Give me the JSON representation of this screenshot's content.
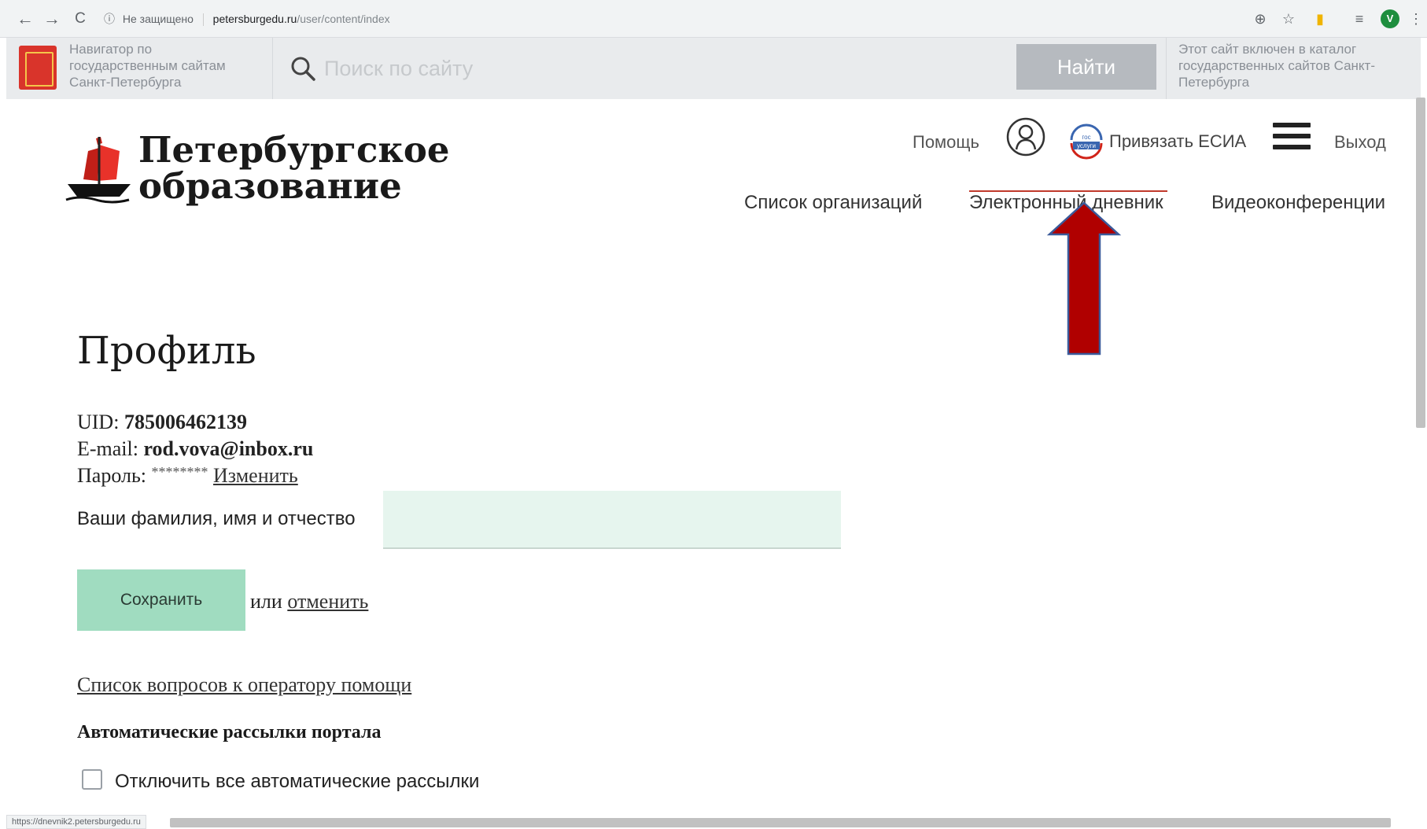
{
  "browser": {
    "back": "←",
    "forward": "→",
    "reload": "C",
    "security_icon": "ⓘ",
    "security_text": "Не защищено",
    "url_host": "petersburgedu.ru",
    "url_path": "/user/content/index",
    "zoom": "⊕",
    "star": "☆",
    "ext": "▮",
    "playlist": "≡",
    "avatar_letter": "V",
    "more": "⋮"
  },
  "gov_strip": {
    "navigator_text": "Навигатор по государственным сайтам Санкт-Петербурга",
    "search_placeholder": "Поиск по сайту",
    "find_label": "Найти",
    "catalog_text": "Этот сайт включен в каталог государственных сайтов Санкт-Петербурга"
  },
  "header": {
    "logo_line1": "Петербургское",
    "logo_line2": "образование",
    "help": "Помощь",
    "esia": "Привязать ЕСИА",
    "logout": "Выход",
    "gos_label_top": "гос",
    "gos_label_bottom": "услуги",
    "nav": [
      "Список организаций",
      "Электронный дневник",
      "Видеоконференции"
    ]
  },
  "profile": {
    "title": "Профиль",
    "uid_label": "UID: ",
    "uid_value": "785006462139",
    "email_label": "E-mail: ",
    "email_value": "rod.vova@inbox.ru",
    "password_label": "Пароль: ",
    "password_value": "********",
    "password_change": "Изменить",
    "fio_label": "Ваши фамилия, имя и отчество",
    "fio_value": "",
    "save_label": "Сохранить",
    "or_text": "или ",
    "cancel_label": "отменить",
    "questions_link": "Список вопросов к оператору помощи",
    "mailing_heading": "Автоматические рассылки портала",
    "mailing_checkbox_label": "Отключить все автоматические рассылки",
    "mailing_checked": false
  },
  "status_bar": {
    "url": "https://dnevnik2.petersburgedu.ru"
  },
  "colors": {
    "accent_green": "#a0dcc0",
    "input_bg": "#e6f5ee",
    "arrow_red": "#b00000",
    "arrow_outline": "#3a5a9a"
  }
}
